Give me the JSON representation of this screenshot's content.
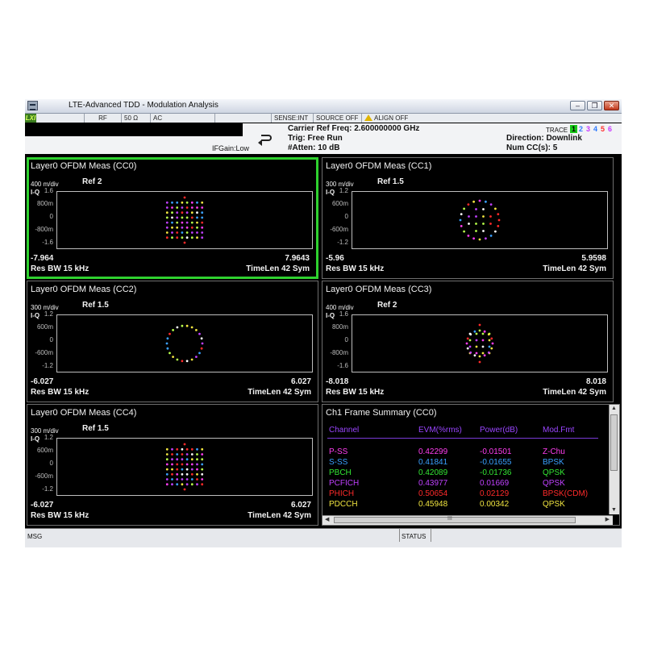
{
  "window": {
    "title": "LTE-Advanced TDD - Modulation Analysis",
    "minimize": "–",
    "restore": "❐",
    "close": "✕"
  },
  "statusbar": {
    "lxi": "LXI",
    "rf": "RF",
    "impedance": "50 Ω",
    "coupling": "AC",
    "sense": "SENSE:INT",
    "source": "SOURCE OFF",
    "align": "ALIGN OFF"
  },
  "settings": {
    "carrier_freq": "Carrier Ref Freq: 2.600000000 GHz",
    "trig": "Trig: Free Run",
    "atten": "#Atten: 10 dB",
    "ifgain": "IFGain:Low",
    "direction": "Direction: Downlink",
    "num_cc": "Num CC(s): 5",
    "trace_label": "TRACE",
    "trace_numbers": [
      "1",
      "2",
      "3",
      "4",
      "5",
      "6"
    ],
    "trace_colors": [
      "#000000",
      "#2f7bff",
      "#c838ff",
      "#2f7bff",
      "#ff3030",
      "#c838ff"
    ]
  },
  "panels": [
    {
      "title": "Layer0 OFDM Meas (CC0)",
      "div": "400 m/div",
      "iq": "I-Q",
      "ref": "Ref 2",
      "yticks": [
        "1.6",
        "800m",
        "0",
        "-800m",
        "-1.6"
      ],
      "xmin": "-7.964",
      "xmax": "7.9643",
      "res_bw": "Res BW 15 kHz",
      "timelen": "TimeLen 42  Sym",
      "active": true,
      "constellation": "qam64"
    },
    {
      "title": "Layer0 OFDM Meas (CC1)",
      "div": "300 m/div",
      "iq": "I-Q",
      "ref": "Ref 1.5",
      "yticks": [
        "1.2",
        "600m",
        "0",
        "-600m",
        "-1.2"
      ],
      "xmin": "-5.96",
      "xmax": "5.9598",
      "res_bw": "Res BW 15 kHz",
      "timelen": "TimeLen 42  Sym",
      "active": false,
      "constellation": "qam16ring"
    },
    {
      "title": "Layer0 OFDM Meas (CC2)",
      "div": "300 m/div",
      "iq": "I-Q",
      "ref": "Ref 1.5",
      "yticks": [
        "1.2",
        "600m",
        "0",
        "-600m",
        "-1.2"
      ],
      "xmin": "-6.027",
      "xmax": "6.027",
      "res_bw": "Res BW 15 kHz",
      "timelen": "TimeLen 42  Sym",
      "active": false,
      "constellation": "ring"
    },
    {
      "title": "Layer0 OFDM Meas (CC3)",
      "div": "400 m/div",
      "iq": "I-Q",
      "ref": "Ref 2",
      "yticks": [
        "1.6",
        "800m",
        "0",
        "-800m",
        "-1.6"
      ],
      "xmin": "-8.018",
      "xmax": "8.018",
      "res_bw": "Res BW 15 kHz",
      "timelen": "TimeLen 42  Sym",
      "active": false,
      "constellation": "qam16"
    },
    {
      "title": "Layer0 OFDM Meas (CC4)",
      "div": "300 m/div",
      "iq": "I-Q",
      "ref": "Ref 1.5",
      "yticks": [
        "1.2",
        "600m",
        "0",
        "-600m",
        "-1.2"
      ],
      "xmin": "-6.027",
      "xmax": "6.027",
      "res_bw": "Res BW 15 kHz",
      "timelen": "TimeLen 42  Sym",
      "active": false,
      "constellation": "qam64"
    }
  ],
  "summary": {
    "title": "Ch1 Frame Summary (CC0)",
    "headers": [
      "Channel",
      "EVM(%rms)",
      "Power(dB)",
      "Mod.Fmt"
    ],
    "rows": [
      {
        "channel": "P-SS",
        "evm": "0.42299",
        "power": "-0.01501",
        "mod": "Z-Chu",
        "color": "#ff3df0"
      },
      {
        "channel": "S-SS",
        "evm": "0.41841",
        "power": "-0.01655",
        "mod": "BPSK",
        "color": "#3aa0ff"
      },
      {
        "channel": "PBCH",
        "evm": "0.42089",
        "power": "-0.01736",
        "mod": "QPSK",
        "color": "#33e633"
      },
      {
        "channel": "PCFICH",
        "evm": "0.43977",
        "power": "0.01669",
        "mod": "QPSK",
        "color": "#c040ff"
      },
      {
        "channel": "PHICH",
        "evm": "0.50654",
        "power": "0.02129",
        "mod": "BPSK(CDM)",
        "color": "#ff2a2a"
      },
      {
        "channel": "PDCCH",
        "evm": "0.45948",
        "power": "0.00342",
        "mod": "QPSK",
        "color": "#f2e640"
      }
    ],
    "hscroll_grip": "III"
  },
  "bottombar": {
    "msg": "MSG",
    "status": "STATUS"
  }
}
